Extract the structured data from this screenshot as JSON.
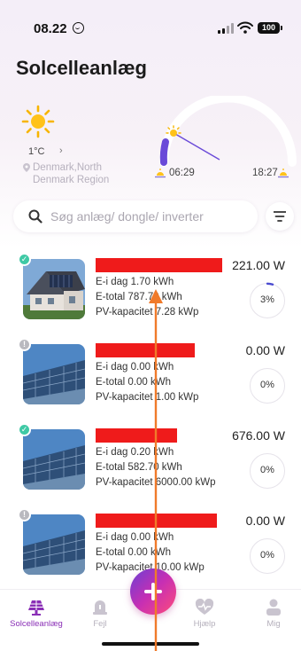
{
  "status_bar": {
    "time": "08.22",
    "battery": "100"
  },
  "page_title": "Solcelleanlæg",
  "weather": {
    "temperature": "1°C",
    "location_line1": "Denmark,North",
    "location_line2": "Denmark Region",
    "sunrise": "06:29",
    "sunset": "18:27"
  },
  "search": {
    "placeholder": "Søg anlæg/ dongle/ inverter"
  },
  "plants": [
    {
      "status": "ok",
      "power": "221.00 W",
      "e_day": "E-i dag 1.70 kWh",
      "e_total": "E-total 787.70 kWh",
      "pv_capacity": "PV-kapacitet 7.28 kWp",
      "percent": "3%",
      "percent_value": 0.03
    },
    {
      "status": "warning",
      "power": "0.00 W",
      "e_day": "E-i dag 0.00 kWh",
      "e_total": "E-total 0.00 kWh",
      "pv_capacity": "PV-kapacitet 1.00 kWp",
      "percent": "0%",
      "percent_value": 0
    },
    {
      "status": "ok",
      "power": "676.00 W",
      "e_day": "E-i dag 0.20 kWh",
      "e_total": "E-total 582.70 kWh",
      "pv_capacity": "PV-kapacitet 6000.00 kWp",
      "percent": "0%",
      "percent_value": 0
    },
    {
      "status": "warning",
      "power": "0.00 W",
      "e_day": "E-i dag 0.00 kWh",
      "e_total": "E-total 0.00 kWh",
      "pv_capacity": "PV-kapacitet 10.00 kWp",
      "percent": "0%",
      "percent_value": 0
    }
  ],
  "tabs": [
    {
      "label": "Solcelleanlæg",
      "icon": "solar-panel-icon",
      "active": true
    },
    {
      "label": "Fejl",
      "icon": "alarm-bell-icon",
      "active": false
    },
    {
      "label": "Hjælp",
      "icon": "heart-pulse-icon",
      "active": false
    },
    {
      "label": "Mig",
      "icon": "person-icon",
      "active": false
    }
  ],
  "colors": {
    "accent": "#8a2fb6",
    "status_ok": "#3fc9a5",
    "status_warning": "#b9b9bf",
    "redaction": "#ef1b1b",
    "annotation_arrow": "#f07a2a"
  }
}
